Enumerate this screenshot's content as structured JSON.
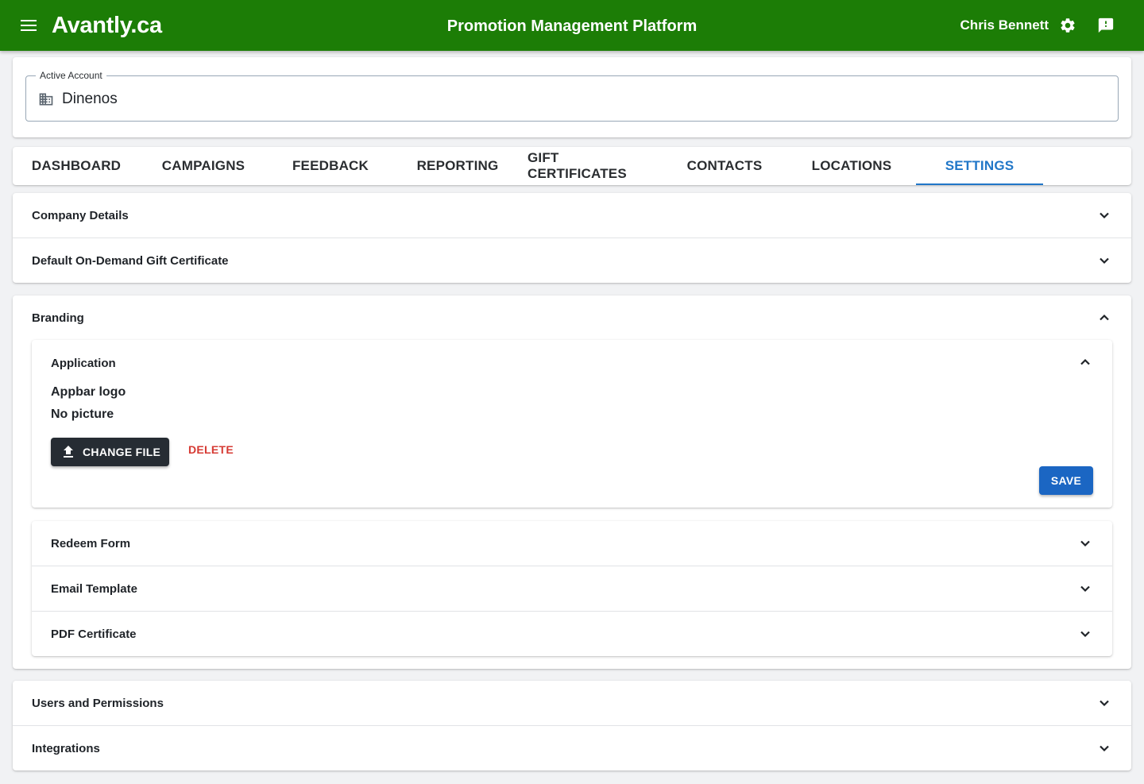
{
  "appbar": {
    "brand": "Avantly.ca",
    "title": "Promotion Management Platform",
    "user_name": "Chris Bennett",
    "color": "#1c7d06",
    "icons": [
      "menu-icon",
      "gear-icon",
      "feedback-icon"
    ]
  },
  "account": {
    "legend": "Active Account",
    "value": "Dinenos",
    "icon": "domain-icon"
  },
  "tabs": [
    {
      "label": "DASHBOARD",
      "active": false
    },
    {
      "label": "CAMPAIGNS",
      "active": false
    },
    {
      "label": "FEEDBACK",
      "active": false
    },
    {
      "label": "REPORTING",
      "active": false
    },
    {
      "label": "GIFT CERTIFICATES",
      "active": false
    },
    {
      "label": "CONTACTS",
      "active": false
    },
    {
      "label": "LOCATIONS",
      "active": false
    },
    {
      "label": "SETTINGS",
      "active": true
    }
  ],
  "settings": {
    "sections_top": [
      "Company Details",
      "Default On-Demand Gift Certificate"
    ],
    "branding": {
      "title": "Branding",
      "expanded": true,
      "application": {
        "title": "Application",
        "expanded": true,
        "field_label": "Appbar logo",
        "picture_status": "No picture",
        "change_file_label": "CHANGE FILE",
        "delete_label": "DELETE",
        "save_label": "SAVE"
      },
      "subsections": [
        "Redeem Form",
        "Email Template",
        "PDF Certificate"
      ]
    },
    "sections_bottom": [
      "Users and Permissions",
      "Integrations"
    ]
  },
  "colors": {
    "accent": "#2177c8",
    "primary_button": "#1b66c3",
    "dark_button": "#262c33",
    "danger": "#d63a33"
  }
}
